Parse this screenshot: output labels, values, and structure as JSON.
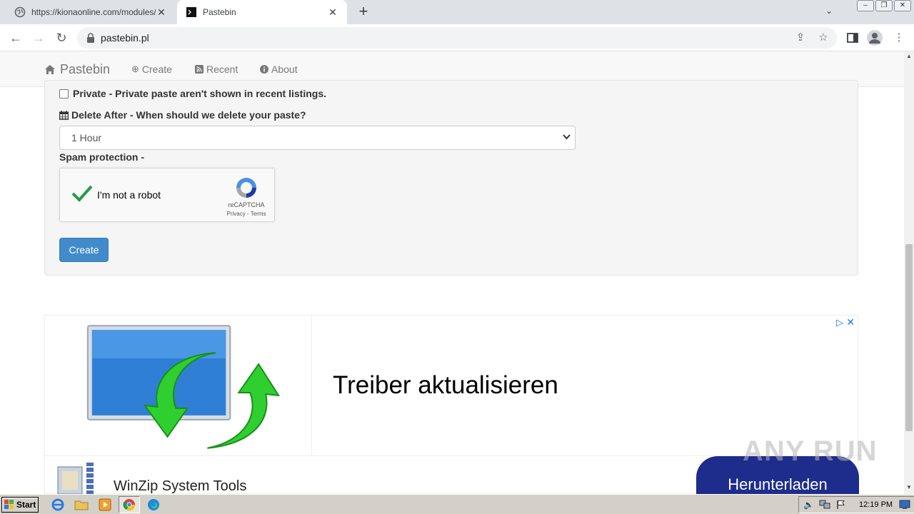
{
  "browser": {
    "tabs": [
      {
        "title": "https://kionaonline.com/modules/bo",
        "active": false
      },
      {
        "title": "Pastebin",
        "active": true
      }
    ],
    "url": "pastebin.pl"
  },
  "site": {
    "brand": "Pastebin",
    "nav": [
      {
        "label": "Create",
        "icon": "plus-circle-icon"
      },
      {
        "label": "Recent",
        "icon": "rss-icon"
      },
      {
        "label": "About",
        "icon": "info-circle-icon"
      }
    ]
  },
  "form": {
    "private_label": "Private - Private paste aren't shown in recent listings.",
    "private_checked": false,
    "delete_label": "Delete After - When should we delete your paste?",
    "delete_selected": "1 Hour",
    "spam_label": "Spam protection -",
    "recaptcha": {
      "text": "I'm not a robot",
      "brand": "reCAPTCHA",
      "links": "Privacy - Terms",
      "checked": true
    },
    "create_label": "Create"
  },
  "ad": {
    "headline": "Treiber aktualisieren",
    "app_name": "WinZip System Tools",
    "cta": "Herunterladen"
  },
  "watermark": "ANY RUN",
  "taskbar": {
    "start_label": "Start",
    "clock": "12:19 PM"
  },
  "colors": {
    "primary_button": "#428bca",
    "ad_cta": "#1e2d8c",
    "ad_link": "#1a73e8"
  }
}
